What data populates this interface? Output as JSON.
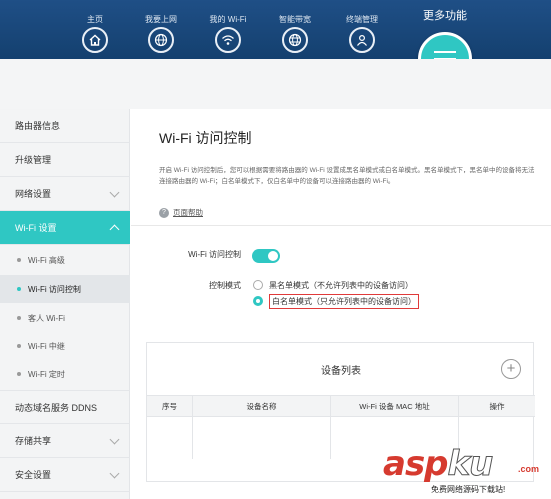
{
  "topnav": {
    "items": [
      {
        "label": "主页",
        "icon": "home-icon"
      },
      {
        "label": "我要上网",
        "icon": "globe-icon"
      },
      {
        "label": "我的 Wi-Fi",
        "icon": "wifi-icon"
      },
      {
        "label": "智能带宽",
        "icon": "globe-icon"
      },
      {
        "label": "终端管理",
        "icon": "user-icon"
      }
    ],
    "more": {
      "label": "更多功能",
      "icon": "menu-icon"
    }
  },
  "sidebar": {
    "items": [
      {
        "label": "路由器信息"
      },
      {
        "label": "升级管理"
      },
      {
        "label": "网络设置"
      },
      {
        "label": "Wi-Fi 设置"
      },
      {
        "label": "动态域名服务 DDNS"
      },
      {
        "label": "存储共享"
      },
      {
        "label": "安全设置"
      }
    ],
    "sub_items": [
      {
        "label": "Wi-Fi 高级"
      },
      {
        "label": "Wi-Fi 访问控制"
      },
      {
        "label": "客人 Wi-Fi"
      },
      {
        "label": "Wi-Fi 中继"
      },
      {
        "label": "Wi-Fi 定时"
      }
    ]
  },
  "main": {
    "title": "Wi-Fi 访问控制",
    "description": "开启 Wi-Fi 访问控制后，您可以根据需要将路由器的 Wi-Fi 设置成黑名单模式或白名单模式。黑名单模式下，黑名单中的设备将无法连接路由器的 Wi-Fi；白名单模式下，仅白名单中的设备可以连接路由器的 Wi-Fi。",
    "help_label": "页面帮助",
    "toggle_label": "Wi-Fi 访问控制",
    "toggle_on": true,
    "mode_label": "控制模式",
    "modes": [
      {
        "label": "黑名单模式（不允许列表中的设备访问）",
        "selected": false
      },
      {
        "label": "白名单模式（只允许列表中的设备访问）",
        "selected": true
      }
    ],
    "device_list": {
      "title": "设备列表",
      "columns": [
        "序号",
        "设备名称",
        "Wi-Fi 设备 MAC 地址",
        "操作"
      ]
    }
  },
  "watermark": {
    "text_a": "asp",
    "text_b": "ku",
    "suffix": ".com",
    "sub": "免费网络源码下载站!"
  },
  "colors": {
    "header": "#1f4f86",
    "accent": "#2fc7c3",
    "highlight_border": "#e03a3a"
  }
}
